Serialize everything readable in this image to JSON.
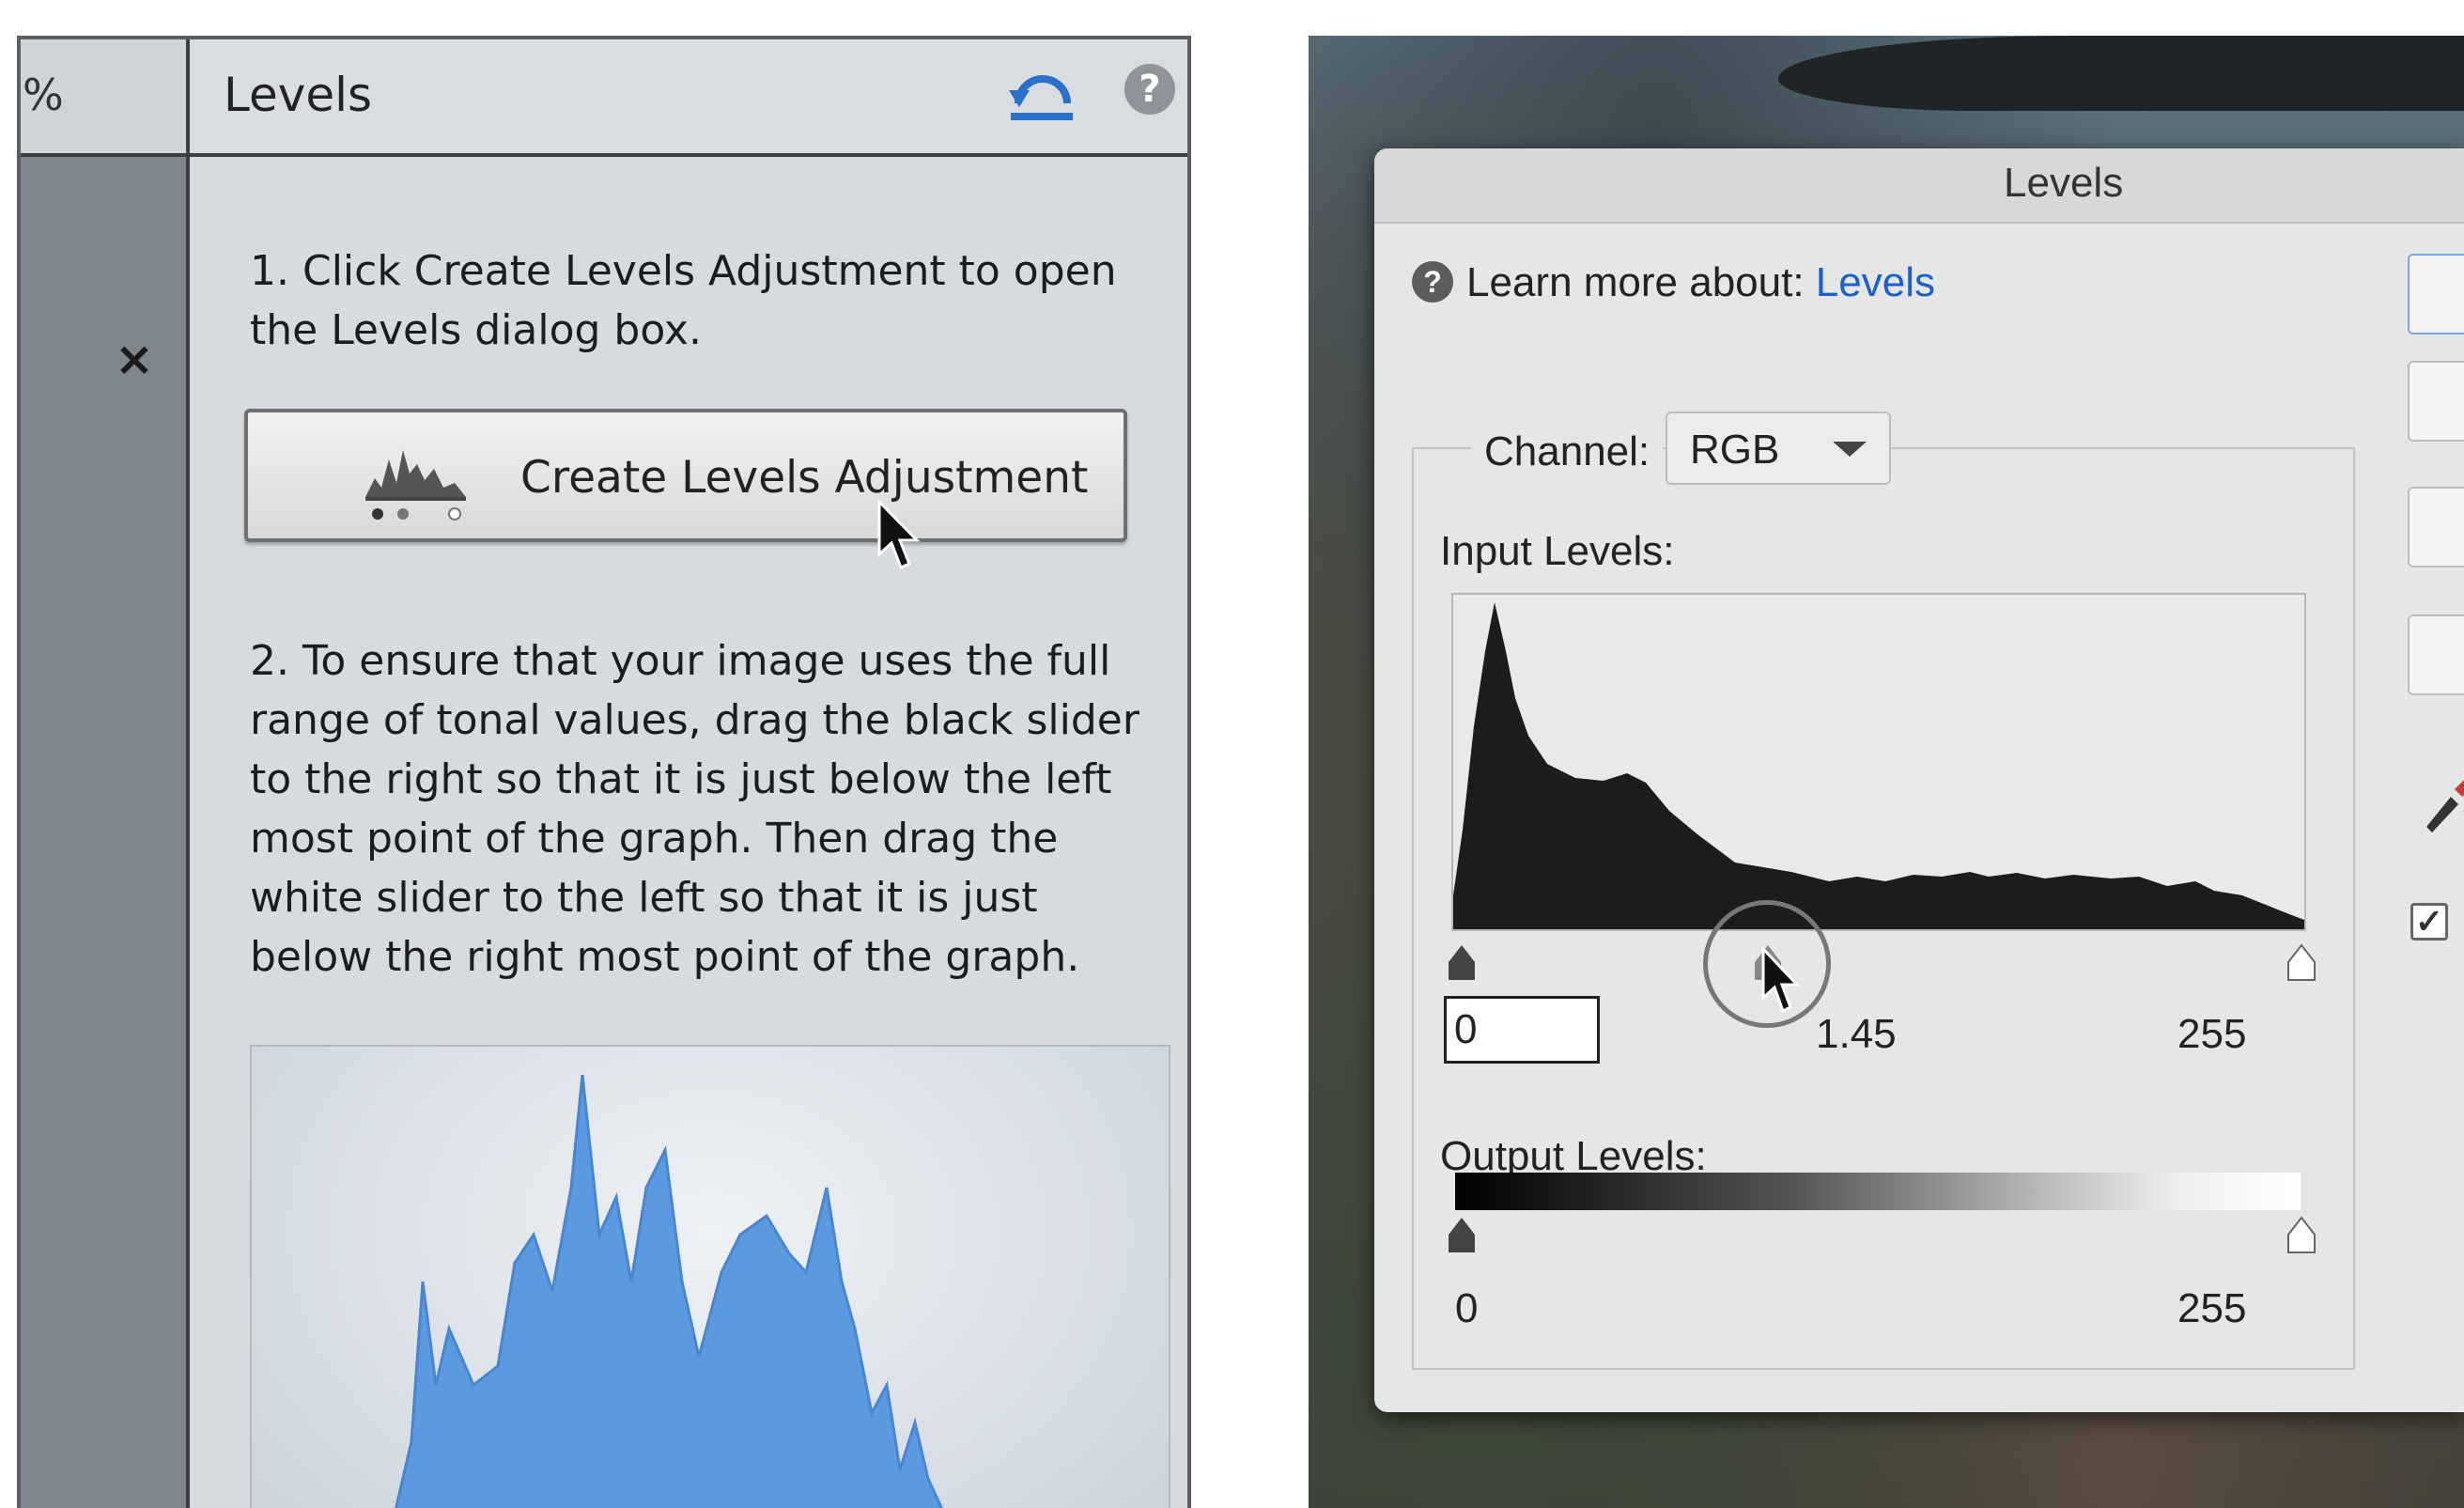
{
  "guided_panel": {
    "gutter_percent_glyph": "%",
    "title": "Levels",
    "close_glyph": "×",
    "step1_text": "1. Click Create Levels Adjustment to open the Levels dialog box.",
    "create_button_label": "Create Levels Adjustment",
    "step2_text": "2. To ensure that your image uses the full range of tonal values, drag the black slider to the right so that it is just below the left most point of the graph. Then drag the white slider to the left so that it is just below the right most point of the graph.",
    "help_glyph": "?"
  },
  "levels_dialog": {
    "title": "Levels",
    "learn_more_prefix": "Learn more about:",
    "learn_more_link": "Levels",
    "help_glyph": "?",
    "channel_label": "Channel:",
    "channel_value": "RGB",
    "input_levels_label": "Input Levels:",
    "input_black": "0",
    "input_gamma": "1.45",
    "input_white": "255",
    "output_levels_label": "Output Levels:",
    "output_black": "0",
    "output_white": "255",
    "preview_checked": true,
    "check_glyph": "✓"
  },
  "colors": {
    "link": "#1a5fd0",
    "preview_histogram_fill": "#5b9ae0",
    "dialog_histogram_fill": "#1c1c1c",
    "sidebar": "#7d858d"
  }
}
